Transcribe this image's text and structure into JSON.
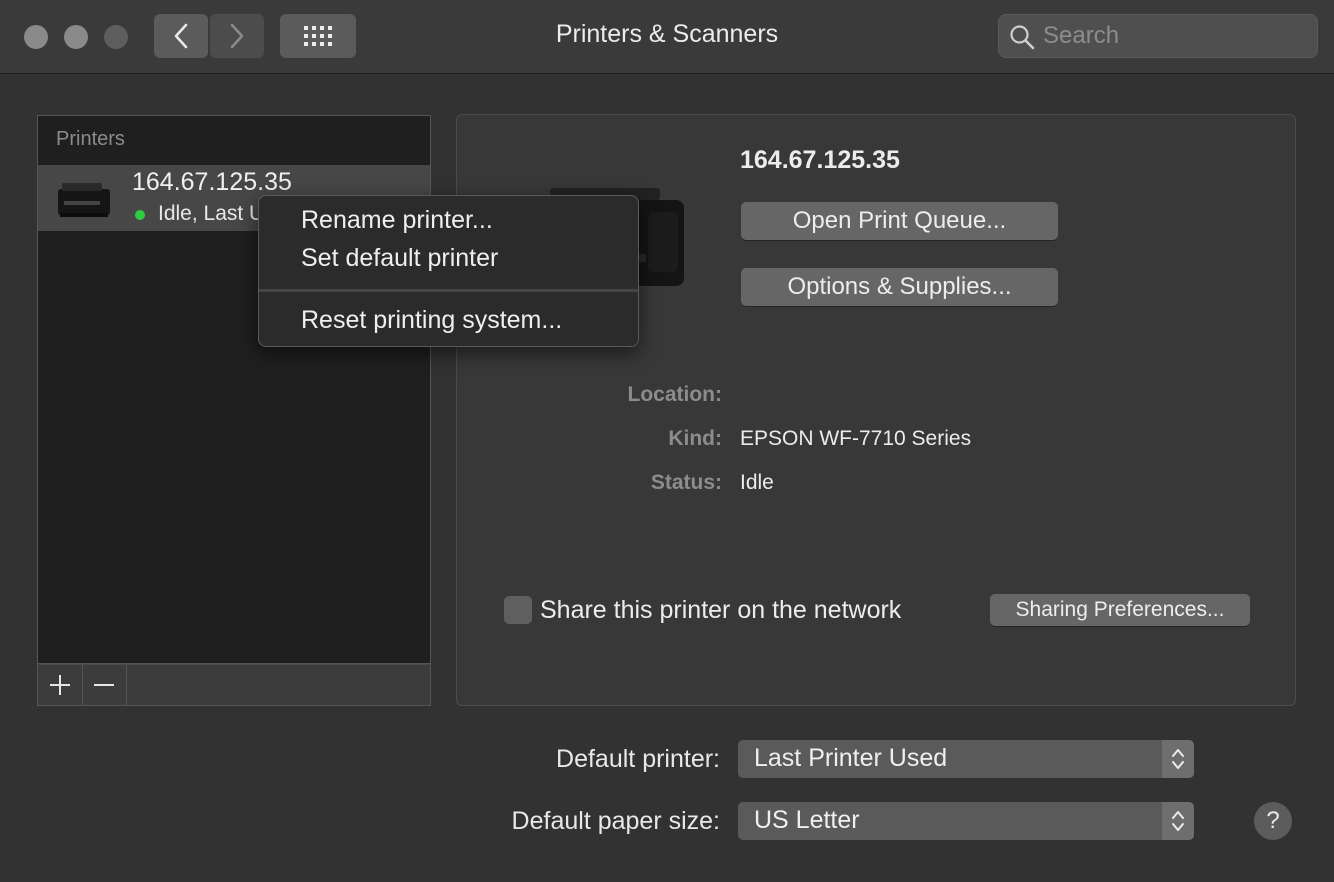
{
  "window": {
    "title": "Printers & Scanners"
  },
  "toolbar": {
    "search_placeholder": "Search",
    "back_icon": "chevron-left-icon",
    "forward_icon": "chevron-right-icon",
    "grid_icon": "grid-icon"
  },
  "printers": {
    "header": "Printers",
    "items": [
      {
        "name": "164.67.125.35",
        "status": "Idle, Last Used"
      }
    ],
    "add_icon": "plus-icon",
    "remove_icon": "minus-icon"
  },
  "context_menu": {
    "items": [
      "Rename printer...",
      "Set default printer",
      "Reset printing system..."
    ]
  },
  "details": {
    "name": "164.67.125.35",
    "open_queue": "Open Print Queue...",
    "options_supplies": "Options & Supplies...",
    "location_label": "Location:",
    "location_value": "",
    "kind_label": "Kind:",
    "kind_value": "EPSON WF-7710 Series",
    "status_label": "Status:",
    "status_value": "Idle",
    "share_label": "Share this printer on the network",
    "share_checked": false,
    "sharing_prefs": "Sharing Preferences..."
  },
  "defaults": {
    "printer_label": "Default printer:",
    "printer_value": "Last Printer Used",
    "paper_label": "Default paper size:",
    "paper_value": "US Letter",
    "help": "?"
  },
  "colors": {
    "status_idle": "#2ecc40",
    "window_bg": "#323232"
  }
}
